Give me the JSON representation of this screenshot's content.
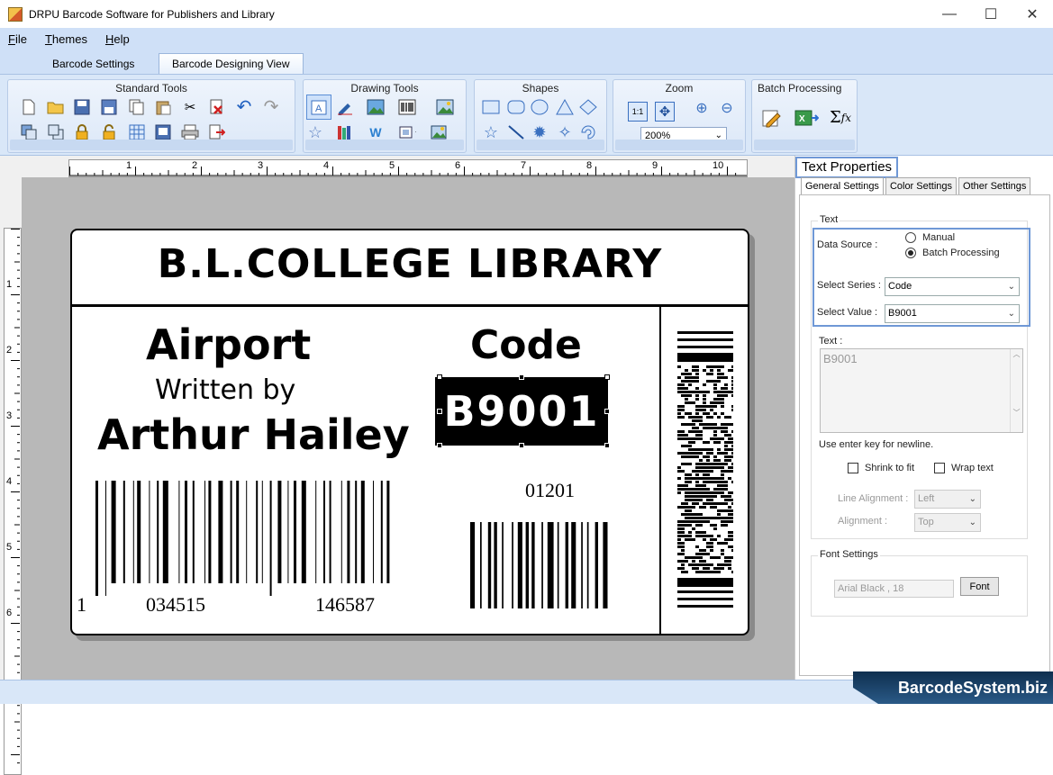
{
  "window": {
    "title": "DRPU Barcode Software for Publishers and Library",
    "minimize_glyph": "—",
    "maximize_glyph": "☐",
    "close_glyph": "✕"
  },
  "menu": {
    "items": [
      {
        "underline": "F",
        "rest": "ile"
      },
      {
        "underline": "T",
        "rest": "hemes"
      },
      {
        "underline": "H",
        "rest": "elp"
      }
    ]
  },
  "tabs": {
    "barcode_settings": "Barcode Settings",
    "barcode_designing_view": "Barcode Designing View"
  },
  "ribbon": {
    "standard_tools": "Standard Tools",
    "drawing_tools": "Drawing Tools",
    "shapes": "Shapes",
    "zoom": "Zoom",
    "zoom_value": "200%",
    "batch_processing": "Batch Processing",
    "fit_label": "1:1"
  },
  "rulers": {
    "h": [
      "1",
      "2",
      "3",
      "4",
      "5",
      "6",
      "7",
      "8",
      "9",
      "10"
    ],
    "v": [
      "1",
      "2",
      "3",
      "4",
      "5",
      "6"
    ]
  },
  "label": {
    "title": "B.L.COLLEGE LIBRARY",
    "book": "Airport",
    "written_by": "Written by",
    "author": "Arthur Hailey",
    "code_heading": "Code",
    "code_value": "B9001",
    "barcode1_prefix": "1",
    "barcode1_left": "034515",
    "barcode1_right": "146587",
    "barcode2_value": "01201"
  },
  "properties": {
    "title": "Text Properties",
    "tabs": [
      "General Settings",
      "Color Settings",
      "Other Settings"
    ],
    "text_group": "Text",
    "data_source_label": "Data Source :",
    "radio_manual": "Manual",
    "radio_batch": "Batch Processing",
    "select_series_label": "Select Series :",
    "select_series_value": "Code",
    "select_value_label": "Select Value :",
    "select_value_value": "B9001",
    "text_label": "Text :",
    "text_value": "B9001",
    "hint": "Use enter key for newline.",
    "shrink_to_fit": "Shrink to fit",
    "wrap_text": "Wrap text",
    "line_alignment_label": "Line Alignment :",
    "line_alignment_value": "Left",
    "alignment_label": "Alignment :",
    "alignment_value": "Top",
    "font_settings": "Font Settings",
    "font_value": "Arial Black , 18",
    "font_button": "Font"
  },
  "brand": "BarcodeSystem.biz"
}
